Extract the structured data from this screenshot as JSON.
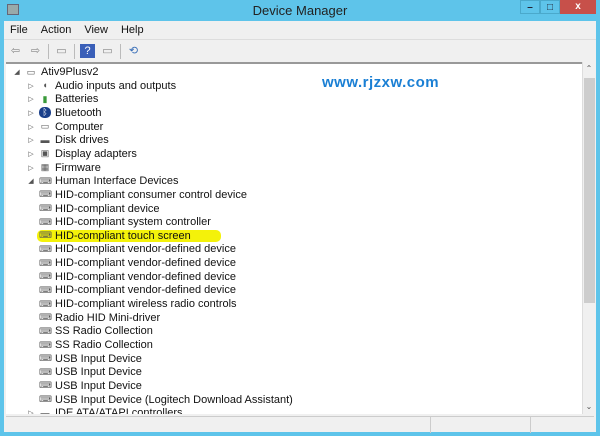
{
  "window": {
    "title": "Device Manager",
    "minimize": "–",
    "maximize": "□",
    "close": "x"
  },
  "menu": [
    "File",
    "Action",
    "View",
    "Help"
  ],
  "toolbar": {
    "back": "⇦",
    "forward": "⇨",
    "properties": "▭",
    "help": "?",
    "update": "▭",
    "scan": "⟲"
  },
  "tree": [
    {
      "label": "Ativ9Plusv2",
      "level": 0,
      "expander": "◢",
      "icon": "computer-icon"
    },
    {
      "label": "Audio inputs and outputs",
      "level": 1,
      "expander": "▷",
      "icon": "speaker-icon"
    },
    {
      "label": "Batteries",
      "level": 1,
      "expander": "▷",
      "icon": "battery-icon"
    },
    {
      "label": "Bluetooth",
      "level": 1,
      "expander": "▷",
      "icon": "bluetooth-icon"
    },
    {
      "label": "Computer",
      "level": 1,
      "expander": "▷",
      "icon": "computer-icon"
    },
    {
      "label": "Disk drives",
      "level": 1,
      "expander": "▷",
      "icon": "disk-icon"
    },
    {
      "label": "Display adapters",
      "level": 1,
      "expander": "▷",
      "icon": "display-icon"
    },
    {
      "label": "Firmware",
      "level": 1,
      "expander": "▷",
      "icon": "firmware-icon"
    },
    {
      "label": "Human Interface Devices",
      "level": 1,
      "expander": "◢",
      "icon": "hid-icon"
    },
    {
      "label": "HID-compliant consumer control device",
      "level": 2,
      "icon": "hid-icon"
    },
    {
      "label": "HID-compliant device",
      "level": 2,
      "icon": "hid-icon"
    },
    {
      "label": "HID-compliant system controller",
      "level": 2,
      "icon": "hid-icon"
    },
    {
      "label": "HID-compliant touch screen",
      "level": 2,
      "icon": "hid-icon",
      "highlighted": true
    },
    {
      "label": "HID-compliant vendor-defined device",
      "level": 2,
      "icon": "hid-icon"
    },
    {
      "label": "HID-compliant vendor-defined device",
      "level": 2,
      "icon": "hid-icon"
    },
    {
      "label": "HID-compliant vendor-defined device",
      "level": 2,
      "icon": "hid-icon"
    },
    {
      "label": "HID-compliant vendor-defined device",
      "level": 2,
      "icon": "hid-icon"
    },
    {
      "label": "HID-compliant wireless radio controls",
      "level": 2,
      "icon": "hid-icon"
    },
    {
      "label": "Radio HID Mini-driver",
      "level": 2,
      "icon": "hid-icon"
    },
    {
      "label": "SS Radio Collection",
      "level": 2,
      "icon": "hid-icon"
    },
    {
      "label": "SS Radio Collection",
      "level": 2,
      "icon": "hid-icon"
    },
    {
      "label": "USB Input Device",
      "level": 2,
      "icon": "hid-icon"
    },
    {
      "label": "USB Input Device",
      "level": 2,
      "icon": "hid-icon"
    },
    {
      "label": "USB Input Device",
      "level": 2,
      "icon": "hid-icon"
    },
    {
      "label": "USB Input Device (Logitech Download Assistant)",
      "level": 2,
      "icon": "hid-icon"
    },
    {
      "label": "IDE ATA/ATAPI controllers",
      "level": 1,
      "expander": "▷",
      "icon": "ide-icon"
    }
  ],
  "scrollbar": {
    "up": "⌃",
    "down": "⌄",
    "position": 0
  },
  "watermark": "www.rjzxw.com",
  "colors": {
    "frame": "#5ec4ea",
    "close": "#c7504a",
    "highlight": "#f4f20a",
    "watermark": "#1a7fd4"
  }
}
